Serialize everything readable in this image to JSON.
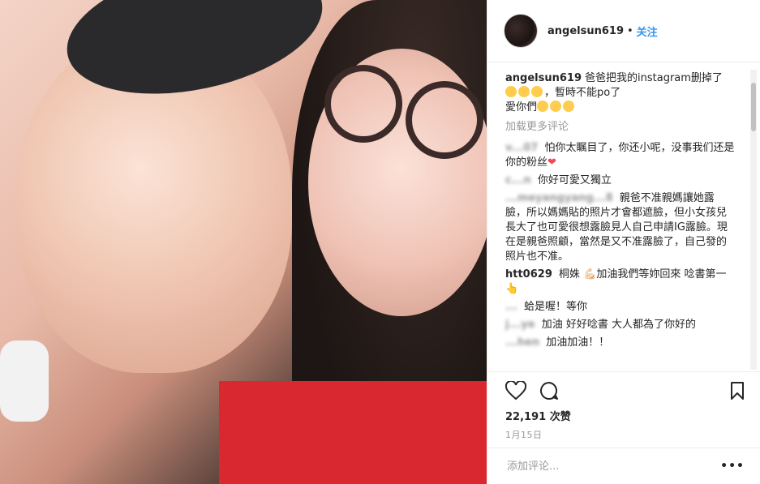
{
  "header": {
    "username": "angelsun619",
    "separator": "•",
    "follow_label": "关注"
  },
  "caption": {
    "username": "angelsun619",
    "text_line1": "爸爸把我的instagram删掉了",
    "text_line2": "，暫時不能po了",
    "text_line3": "愛你們"
  },
  "load_more_label": "加载更多评论",
  "comments": [
    {
      "user": "v...07",
      "text": "怕你太瞩目了，你还小呢，没事我们还是你的粉丝"
    },
    {
      "user": "c...n",
      "text": "你好可愛又獨立"
    },
    {
      "user": "...meyangyang...8",
      "text": "親爸不准親媽讓她露臉，所以媽媽貼的照片才會都遮臉，但小女孩兒長大了也可愛很想露臉見人自己申請IG露臉。現在是親爸照顧，當然是又不准露臉了，自己發的照片也不准。"
    },
    {
      "user": "htt0629",
      "text": "桐姝 💪🏻加油我們等妳回來 唸書第一👆"
    },
    {
      "user": "...",
      "text": "蛤是喔！等你"
    },
    {
      "user": "j...ye",
      "text": "加油 好好唸書 大人都為了你好的"
    },
    {
      "user": "...hen",
      "text": "加油加油！！"
    }
  ],
  "likes": {
    "count": "22,191",
    "label": "次赞"
  },
  "date": "1月15日",
  "add_comment": {
    "placeholder": "添加评论..."
  },
  "icons": {
    "like": "heart-icon",
    "comment": "comment-icon",
    "save": "bookmark-icon",
    "options": "more-options-icon"
  }
}
